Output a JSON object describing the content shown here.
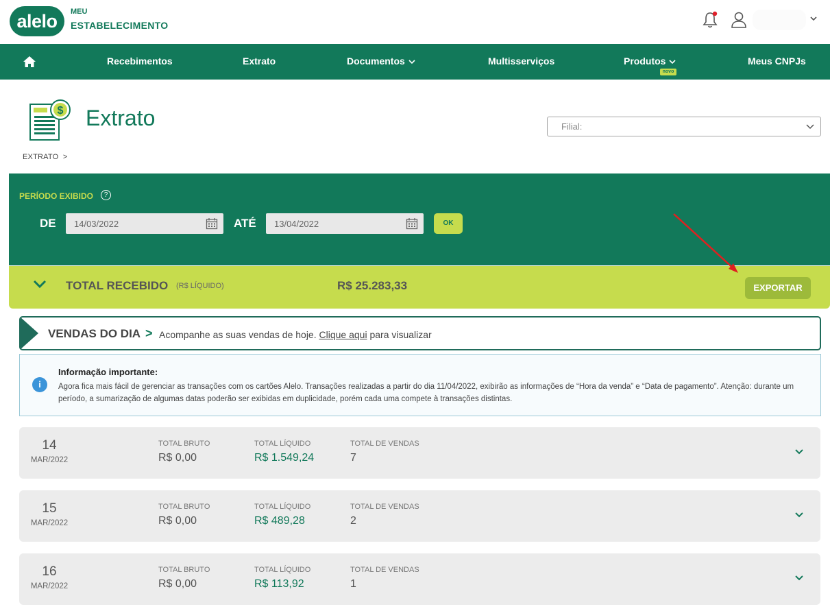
{
  "header": {
    "logo_text": "alelo",
    "brand_sub": "MEU",
    "brand_main": "ESTABELECIMENTO"
  },
  "nav": {
    "items": [
      {
        "label": "Recebimentos"
      },
      {
        "label": "Extrato"
      },
      {
        "label": "Documentos"
      },
      {
        "label": "Multisserviços"
      },
      {
        "label": "Produtos"
      },
      {
        "label": "Meus CNPJs"
      }
    ],
    "novo_badge": "novo"
  },
  "page": {
    "title": "Extrato",
    "breadcrumb": "EXTRATO  >",
    "filial_label": "Filial:"
  },
  "period": {
    "label": "PERÍODO EXIBIDO",
    "help": "?",
    "de_label": "DE",
    "de_value": "14/03/2022",
    "ate_label": "ATÉ",
    "ate_value": "13/04/2022",
    "ok_label": "OK"
  },
  "total": {
    "label": "TOTAL RECEBIDO",
    "sub": "(R$ LÍQUIDO)",
    "value": "R$ 25.283,33",
    "export_label": "EXPORTAR"
  },
  "vendas": {
    "title": "VENDAS DO DIA",
    "gt": ">",
    "text_before": "Acompanhe as suas vendas de hoje.",
    "link": "Clique aqui",
    "text_after": "para visualizar"
  },
  "info": {
    "icon": "i",
    "title": "Informação importante:",
    "text": "Agora fica mais fácil de gerenciar as transações com os cartões Alelo. Transações realizadas a partir do dia 11/04/2022, exibirão as informações de “Hora da venda” e “Data de pagamento”. Atenção: durante um período, a sumarização de algumas datas poderão ser exibidas em duplicidade, porém cada uma compete à transações distintas."
  },
  "columns": {
    "bruto": "TOTAL BRUTO",
    "liquido": "TOTAL LÍQUIDO",
    "vendas": "TOTAL DE VENDAS"
  },
  "days": [
    {
      "day": "14",
      "month": "MAR/2022",
      "bruto": "R$ 0,00",
      "liquido": "R$ 1.549,24",
      "vendas": "7"
    },
    {
      "day": "15",
      "month": "MAR/2022",
      "bruto": "R$ 0,00",
      "liquido": "R$ 489,28",
      "vendas": "2"
    },
    {
      "day": "16",
      "month": "MAR/2022",
      "bruto": "R$ 0,00",
      "liquido": "R$ 113,92",
      "vendas": "1"
    }
  ],
  "colors": {
    "brand_green": "#12795a",
    "lime": "#c6dc4d",
    "export_green": "#9dba3a",
    "info_blue": "#3b94d9",
    "arrow_red": "#e02020"
  },
  "icons": [
    "bell-icon",
    "user-icon",
    "home-icon",
    "calendar-icon",
    "chevron-down-icon",
    "info-icon",
    "help-icon"
  ]
}
